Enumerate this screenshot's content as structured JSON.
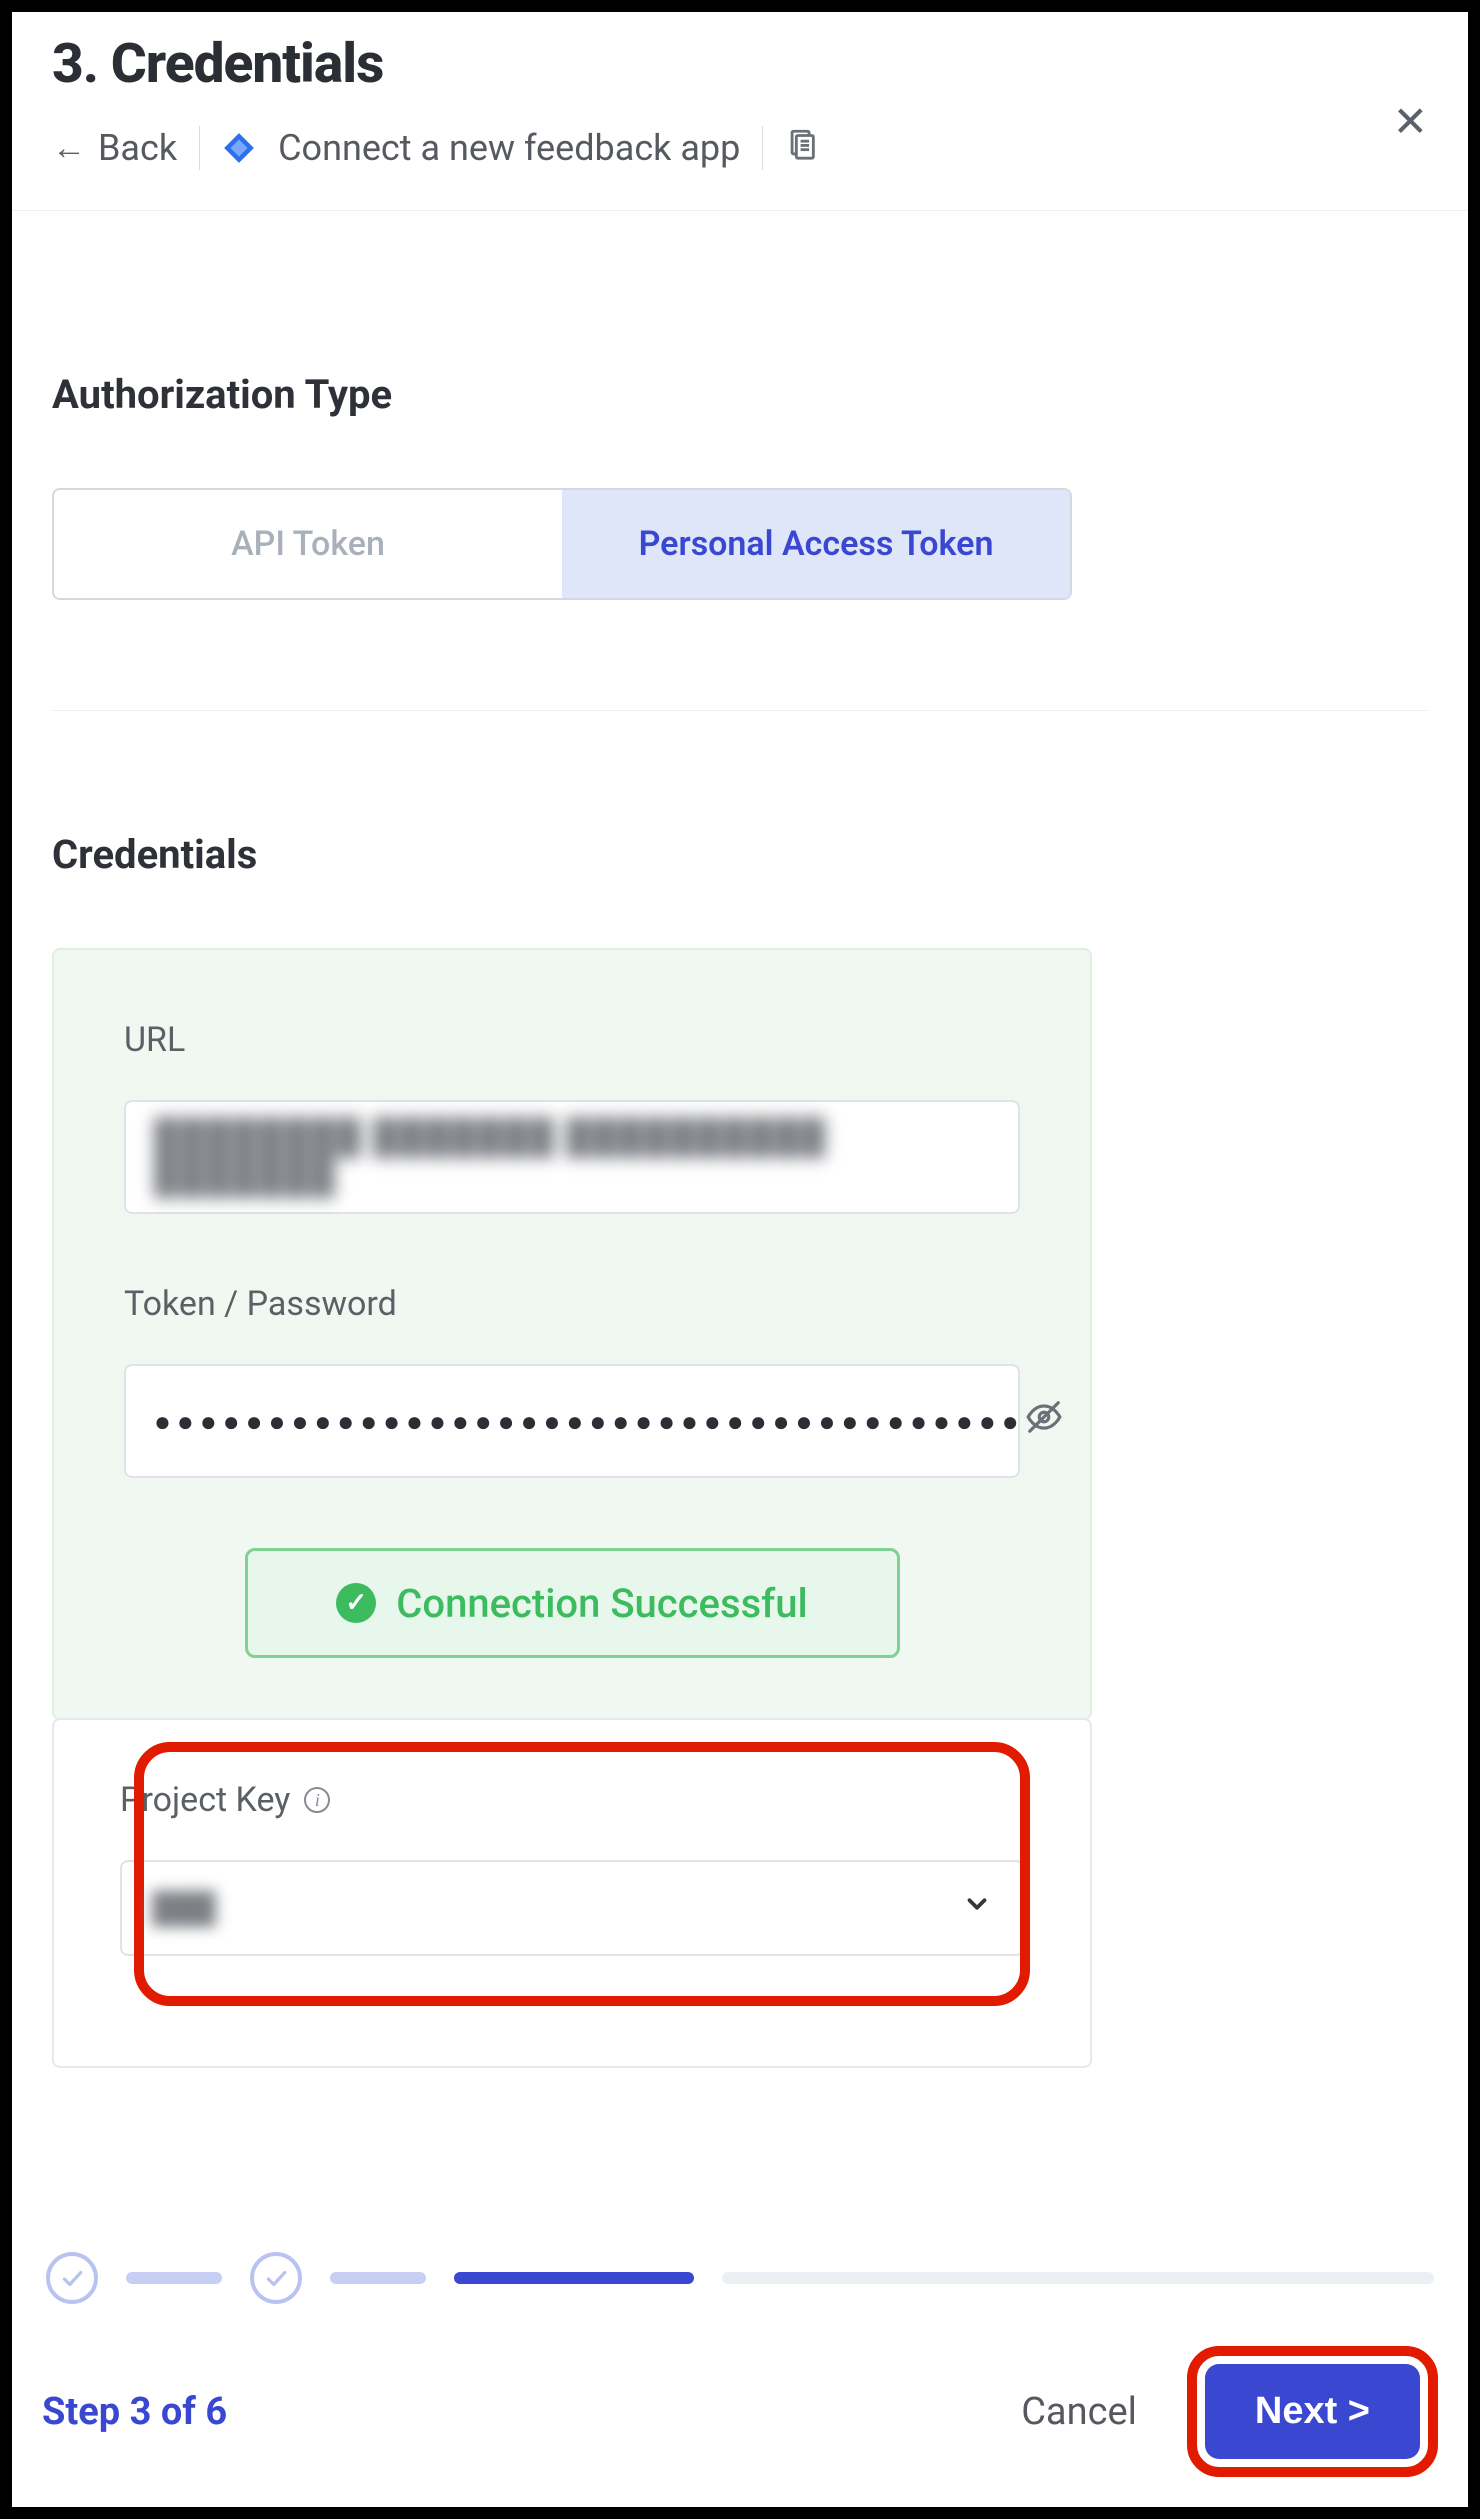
{
  "header": {
    "title": "3. Credentials",
    "back_label": "Back",
    "breadcrumb": "Connect a new feedback app"
  },
  "auth": {
    "section_title": "Authorization Type",
    "tabs": [
      "API Token",
      "Personal Access Token"
    ],
    "active_index": 1
  },
  "credentials": {
    "section_title": "Credentials",
    "url_label": "URL",
    "url_value": "████████ ███████ ██████████ ███████",
    "token_label": "Token / Password",
    "token_masked": "●●●●●●●●●●●●●●●●●●●●●●●●●●●●●●●●●●●●●●",
    "connection_status": "Connection Successful"
  },
  "project": {
    "label": "Project Key",
    "selected_masked": "███"
  },
  "footer": {
    "step_text": "Step 3 of 6",
    "cancel_label": "Cancel",
    "next_label": "Next >"
  }
}
